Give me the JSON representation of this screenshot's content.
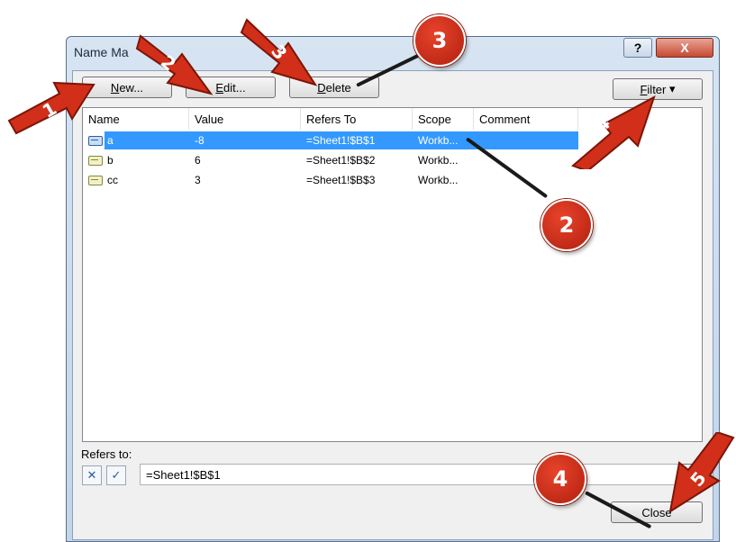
{
  "window": {
    "title": "Name Ma",
    "help_label": "?",
    "close_label": "X"
  },
  "toolbar": {
    "new_label": "New...",
    "edit_label": "Edit...",
    "delete_label": "Delete",
    "filter_label": "Filter",
    "filter_arrow": "▾"
  },
  "list": {
    "columns": [
      "Name",
      "Value",
      "Refers To",
      "Scope",
      "Comment"
    ],
    "rows": [
      {
        "name": "a",
        "value": "-8",
        "refers_to": "=Sheet1!$B$1",
        "scope": "Workb...",
        "comment": "",
        "selected": true
      },
      {
        "name": "b",
        "value": "6",
        "refers_to": "=Sheet1!$B$2",
        "scope": "Workb...",
        "comment": "",
        "selected": false
      },
      {
        "name": "cc",
        "value": "3",
        "refers_to": "=Sheet1!$B$3",
        "scope": "Workb...",
        "comment": "",
        "selected": false
      }
    ]
  },
  "refers": {
    "label": "Refers to:",
    "cancel_icon": "✕",
    "enter_icon": "✓",
    "value": "=Sheet1!$B$1"
  },
  "footer": {
    "close_label": "Close"
  },
  "annotations": {
    "circle_3": "3",
    "circle_2": "2",
    "circle_4": "4",
    "arrow_1": "1",
    "arrow_2": "2",
    "arrow_3": "3",
    "arrow_4": "4",
    "arrow_5": "5",
    "color": "#d12f19"
  }
}
